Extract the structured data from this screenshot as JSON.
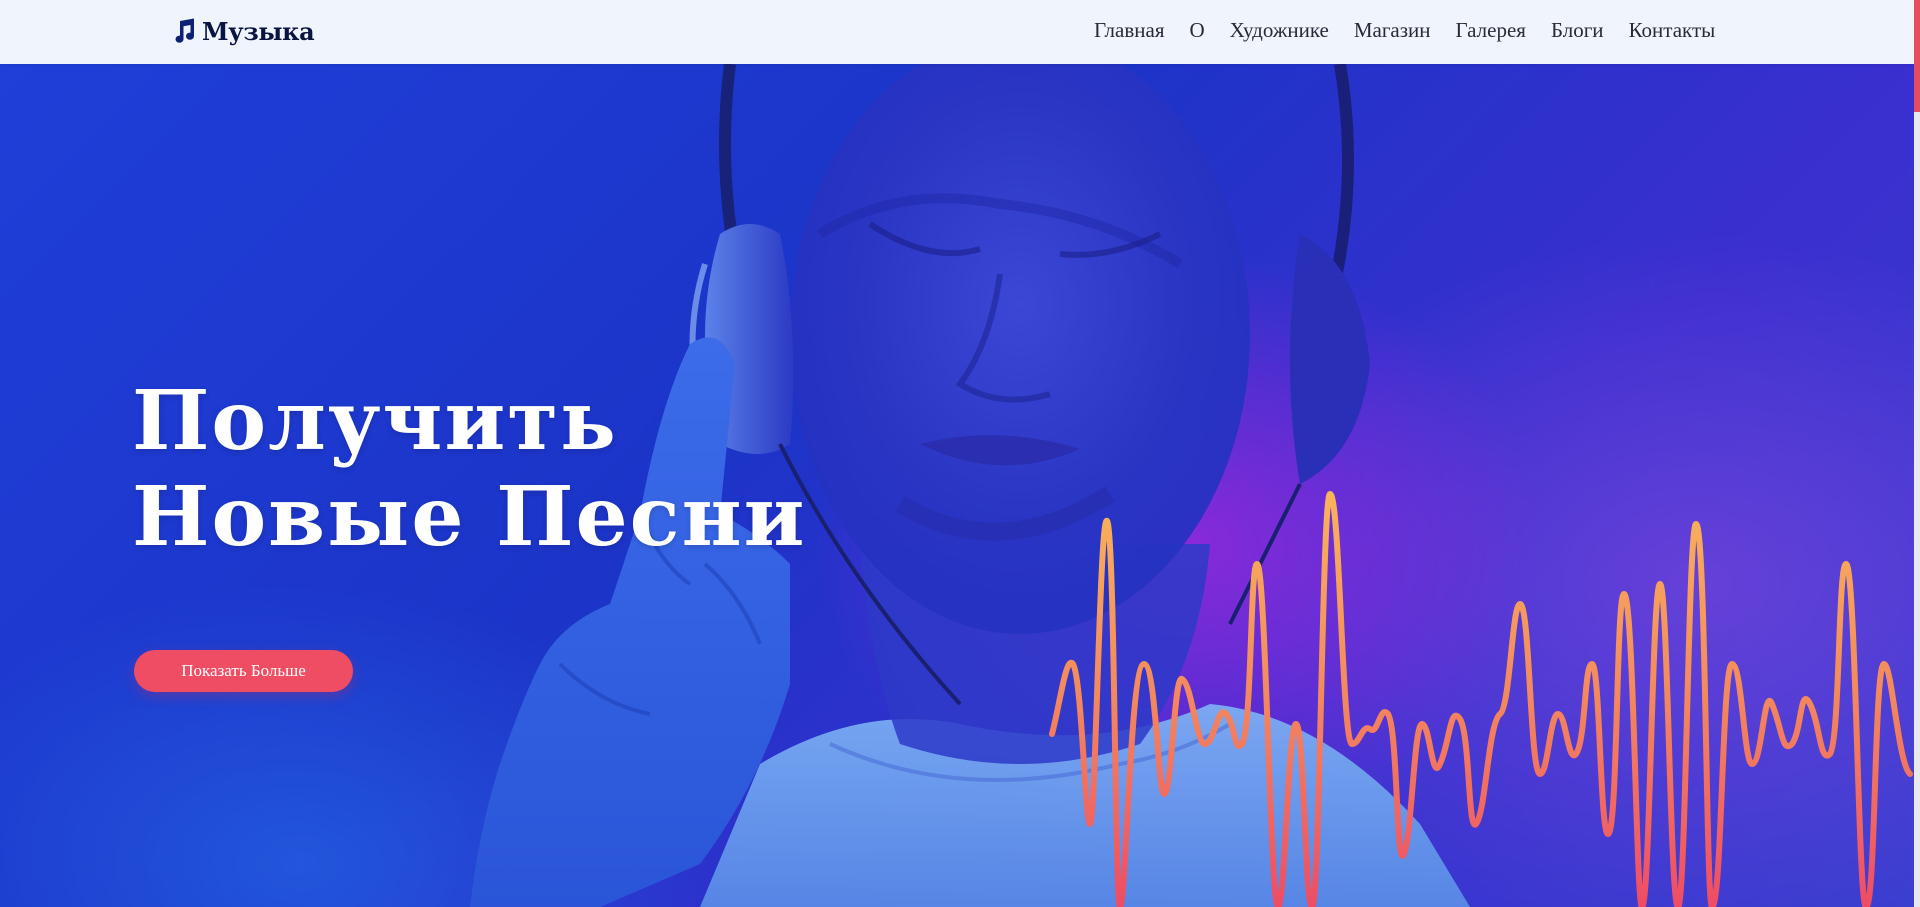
{
  "brand": {
    "name": "Музыка",
    "icon": "music-note-icon"
  },
  "nav": {
    "items": [
      {
        "label": "Главная"
      },
      {
        "label": "О"
      },
      {
        "label": "Художнике"
      },
      {
        "label": "Магазин"
      },
      {
        "label": "Галерея"
      },
      {
        "label": "Блоги"
      },
      {
        "label": "Контакты"
      }
    ]
  },
  "hero": {
    "title_line1": "Получить",
    "title_line2": "Новые Песни",
    "cta_label": "Показать Больше"
  },
  "colors": {
    "navbar_bg": "#f0f4fd",
    "hero_blue": "#1f3fd8",
    "hero_purple": "#9b28dc",
    "accent": "#ef4d64",
    "wave_top": "#f5a45a",
    "wave_bottom": "#f05a62"
  }
}
